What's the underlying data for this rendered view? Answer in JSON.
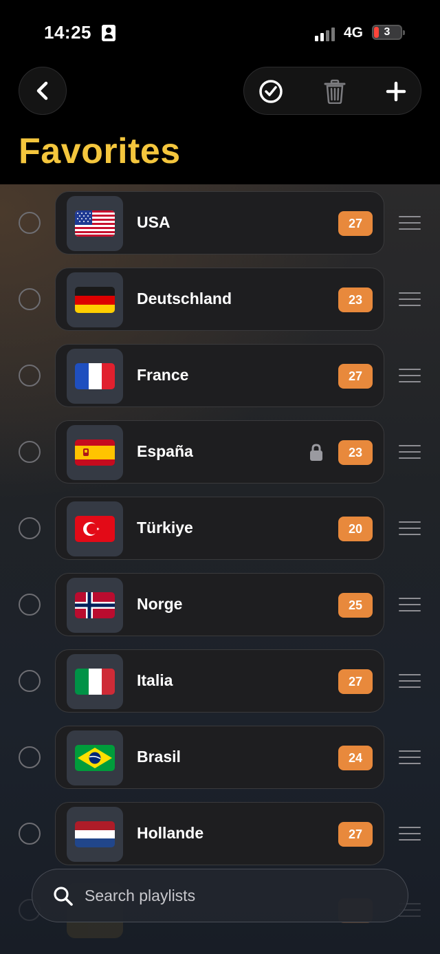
{
  "status_bar": {
    "time": "14:25",
    "network": "4G",
    "battery": "3"
  },
  "nav": {
    "title": "Favorites"
  },
  "colors": {
    "accent": "#f4c63d",
    "badge": "#e8893c"
  },
  "icons": {
    "back": "chevron-left-icon",
    "select": "checkmark-circle-icon",
    "delete": "trash-icon",
    "add": "plus-icon",
    "search": "search-icon"
  },
  "playlists": [
    {
      "name": "USA",
      "count": "27",
      "flag": "us",
      "locked": false
    },
    {
      "name": "Deutschland",
      "count": "23",
      "flag": "de",
      "locked": false
    },
    {
      "name": "France",
      "count": "27",
      "flag": "fr",
      "locked": false
    },
    {
      "name": "España",
      "count": "23",
      "flag": "es",
      "locked": true
    },
    {
      "name": "Türkiye",
      "count": "20",
      "flag": "tr",
      "locked": false
    },
    {
      "name": "Norge",
      "count": "25",
      "flag": "no",
      "locked": false
    },
    {
      "name": "Italia",
      "count": "27",
      "flag": "it",
      "locked": false
    },
    {
      "name": "Brasil",
      "count": "24",
      "flag": "br",
      "locked": false
    },
    {
      "name": "Hollande",
      "count": "27",
      "flag": "nl",
      "locked": false
    }
  ],
  "search": {
    "placeholder": "Search playlists"
  }
}
